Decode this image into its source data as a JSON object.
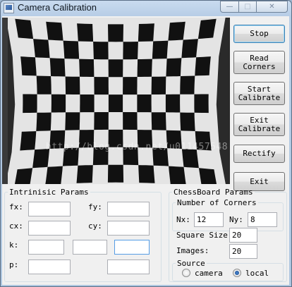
{
  "window": {
    "title": "Camera Calibration",
    "icon": "app-icon"
  },
  "caption": {
    "minimize": "—",
    "maximize": "□",
    "close": "✕"
  },
  "camera": {
    "watermark": "http://blog.csdn.net/u011457548"
  },
  "buttons": {
    "stop": "Stop",
    "read_corners": "Read\nCorners",
    "start_calibrate": "Start\nCalibrate",
    "exit_calibrate": "Exit\nCalibrate",
    "rectify": "Rectify",
    "exit": "Exit"
  },
  "intrinsic": {
    "title": "Intrinisic Params",
    "fx_label": "fx:",
    "fy_label": "fy:",
    "cx_label": "cx:",
    "cy_label": "cy:",
    "k_label": "k:",
    "p_label": "p:",
    "fx": "",
    "fy": "",
    "cx": "",
    "cy": "",
    "k1": "",
    "k2": "",
    "k3": "",
    "p1": "",
    "p2": ""
  },
  "chessboard": {
    "title": "ChessBoard Params",
    "corners_title": "Number of Corners",
    "nx_label": "Nx:",
    "nx": "12",
    "ny_label": "Ny:",
    "ny": "8",
    "square_label": "Square Size:",
    "square": "20",
    "images_label": "Images:",
    "images": "20",
    "source_title": "Source",
    "camera_label": "camera",
    "local_label": "local",
    "selected": "local"
  }
}
